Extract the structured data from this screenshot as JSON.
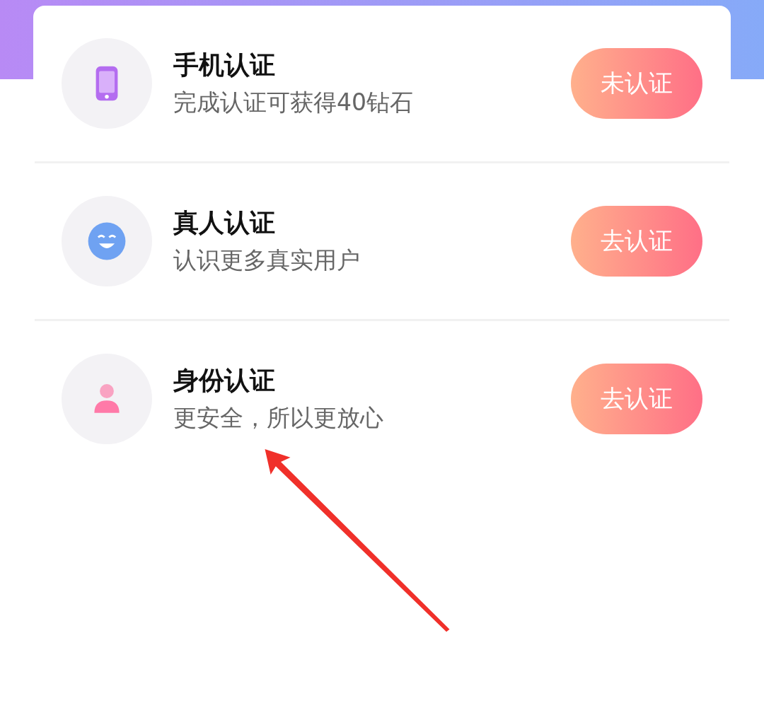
{
  "verifications": [
    {
      "kind": "phone",
      "title": "手机认证",
      "subtitle": "完成认证可获得40钻石",
      "button": "未认证"
    },
    {
      "kind": "face",
      "title": "真人认证",
      "subtitle": "认识更多真实用户",
      "button": "去认证"
    },
    {
      "kind": "person",
      "title": "身份认证",
      "subtitle": "更安全，所以更放心",
      "button": "去认证"
    }
  ],
  "annotation": {
    "kind": "arrow"
  }
}
